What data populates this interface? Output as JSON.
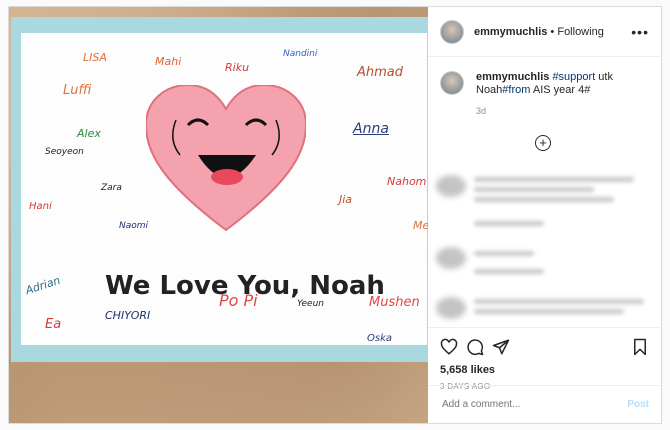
{
  "header": {
    "username": "emmymuchlis",
    "separator": " • ",
    "follow_status": "Following",
    "more_icon": "more-horizontal-icon"
  },
  "caption": {
    "username": "emmymuchlis",
    "hashtag1": "#support",
    "text1": " utk",
    "text2": "Noah",
    "hashtag2": "#from",
    "text3": " AIS year 4#",
    "age": "3d"
  },
  "load_more_icon": "plus-circle-icon",
  "likes": "5,658 likes",
  "date": "3 DAYS AGO",
  "comment": {
    "placeholder": "Add a comment...",
    "post_label": "Post"
  },
  "photo": {
    "headline": "We Love You, Noah",
    "names": [
      "LISA",
      "Mahi",
      "Riku",
      "Nandini",
      "Ahmad",
      "Luffi",
      "Anna",
      "Alex",
      "Seoyeon",
      "Nahom",
      "Zara",
      "Jia",
      "Hani",
      "Naomi",
      "Me",
      "Adrian",
      "Po Pi",
      "Yeeun",
      "Mushen",
      "Ea",
      "CHIYORI",
      "Oska"
    ]
  },
  "colors": {
    "board": "#a9d9de",
    "heart": "#f4a3ae",
    "heart_outline": "#e0707e",
    "link": "#00376b",
    "post_button": "#b2dffc"
  }
}
